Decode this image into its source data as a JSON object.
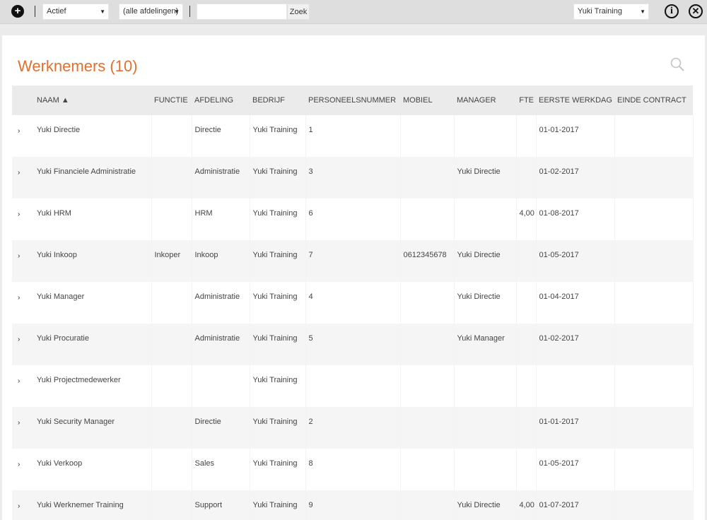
{
  "toolbar": {
    "add_glyph": "+",
    "status_select": "Actief",
    "department_select": "(alle afdelingen)",
    "search_value": "",
    "search_button": "Zoek",
    "company_select": "Yuki Training",
    "info_glyph": "i",
    "close_glyph": "✕",
    "caret_glyph": "▼"
  },
  "page": {
    "title": "Werknemers (10)"
  },
  "table": {
    "expand_glyph": "›",
    "columns": {
      "naam": "NAAM ▲",
      "functie": "FUNCTIE",
      "afdeling": "AFDELING",
      "bedrijf": "BEDRIJF",
      "personeelsnummer": "PERSONEELSNUMMER",
      "mobiel": "MOBIEL",
      "manager": "MANAGER",
      "fte": "FTE",
      "eerste_werkdag": "EERSTE WERKDAG",
      "einde_contract": "EINDE CONTRACT"
    },
    "rows": [
      {
        "naam": "Yuki Directie",
        "functie": "",
        "afdeling": "Directie",
        "bedrijf": "Yuki Training",
        "personeelsnummer": "1",
        "mobiel": "",
        "manager": "",
        "fte": "",
        "eerste_werkdag": "01-01-2017",
        "einde_contract": ""
      },
      {
        "naam": "Yuki Financiele Administratie",
        "functie": "",
        "afdeling": "Administratie",
        "bedrijf": "Yuki Training",
        "personeelsnummer": "3",
        "mobiel": "",
        "manager": "Yuki Directie",
        "fte": "",
        "eerste_werkdag": "01-02-2017",
        "einde_contract": ""
      },
      {
        "naam": "Yuki HRM",
        "functie": "",
        "afdeling": "HRM",
        "bedrijf": "Yuki Training",
        "personeelsnummer": "6",
        "mobiel": "",
        "manager": "",
        "fte": "4,00",
        "eerste_werkdag": "01-08-2017",
        "einde_contract": ""
      },
      {
        "naam": "Yuki Inkoop",
        "functie": "Inkoper",
        "afdeling": "Inkoop",
        "bedrijf": "Yuki Training",
        "personeelsnummer": "7",
        "mobiel": "0612345678",
        "manager": "Yuki Directie",
        "fte": "",
        "eerste_werkdag": "01-05-2017",
        "einde_contract": ""
      },
      {
        "naam": "Yuki Manager",
        "functie": "",
        "afdeling": "Administratie",
        "bedrijf": "Yuki Training",
        "personeelsnummer": "4",
        "mobiel": "",
        "manager": "Yuki Directie",
        "fte": "",
        "eerste_werkdag": "01-04-2017",
        "einde_contract": ""
      },
      {
        "naam": "Yuki Procuratie",
        "functie": "",
        "afdeling": "Administratie",
        "bedrijf": "Yuki Training",
        "personeelsnummer": "5",
        "mobiel": "",
        "manager": "Yuki Manager",
        "fte": "",
        "eerste_werkdag": "01-02-2017",
        "einde_contract": ""
      },
      {
        "naam": "Yuki Projectmedewerker",
        "functie": "",
        "afdeling": "",
        "bedrijf": "Yuki Training",
        "personeelsnummer": "",
        "mobiel": "",
        "manager": "",
        "fte": "",
        "eerste_werkdag": "",
        "einde_contract": ""
      },
      {
        "naam": "Yuki Security Manager",
        "functie": "",
        "afdeling": "Directie",
        "bedrijf": "Yuki Training",
        "personeelsnummer": "2",
        "mobiel": "",
        "manager": "",
        "fte": "",
        "eerste_werkdag": "01-01-2017",
        "einde_contract": ""
      },
      {
        "naam": "Yuki Verkoop",
        "functie": "",
        "afdeling": "Sales",
        "bedrijf": "Yuki Training",
        "personeelsnummer": "8",
        "mobiel": "",
        "manager": "",
        "fte": "",
        "eerste_werkdag": "01-05-2017",
        "einde_contract": ""
      },
      {
        "naam": "Yuki Werknemer Training",
        "functie": "",
        "afdeling": "Support",
        "bedrijf": "Yuki Training",
        "personeelsnummer": "9",
        "mobiel": "",
        "manager": "Yuki Directie",
        "fte": "4,00",
        "eerste_werkdag": "01-07-2017",
        "einde_contract": ""
      }
    ]
  },
  "colors": {
    "accent": "#e07030",
    "toolbar_bg": "#dedede",
    "header_bg": "#ebebeb",
    "alt_row_bg": "#f5f5f5"
  },
  "icons": {
    "add": "plus-circle-icon",
    "info": "info-circle-icon",
    "close": "close-circle-icon",
    "search": "search-icon",
    "expand": "chevron-right-icon"
  }
}
